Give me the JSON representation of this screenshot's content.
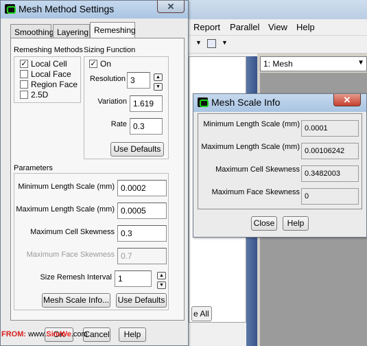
{
  "background": {
    "menu": [
      "Report",
      "Parallel",
      "View",
      "Help"
    ],
    "mesh_combo": "1: Mesh",
    "partial_button": "e All"
  },
  "dialog": {
    "title": "Mesh Method Settings",
    "tabs": [
      "Smoothing",
      "Layering",
      "Remeshing"
    ],
    "remeshing_methods": {
      "title": "Remeshing Methods",
      "items": [
        {
          "label": "Local Cell",
          "checked": true
        },
        {
          "label": "Local Face",
          "checked": false
        },
        {
          "label": "Region Face",
          "checked": false
        },
        {
          "label": "2.5D",
          "checked": false
        }
      ]
    },
    "sizing": {
      "title": "Sizing Function",
      "on_label": "On",
      "on_checked": true,
      "resolution_label": "Resolution",
      "resolution": "3",
      "variation_label": "Variation",
      "variation": "1.619",
      "rate_label": "Rate",
      "rate": "0.3",
      "defaults_btn": "Use Defaults"
    },
    "params": {
      "title": "Parameters",
      "min_len_label": "Minimum Length Scale (mm)",
      "min_len": "0.0002",
      "max_len_label": "Maximum Length Scale (mm)",
      "max_len": "0.0005",
      "max_cell_label": "Maximum Cell Skewness",
      "max_cell": "0.3",
      "max_face_label": "Maximum Face Skewness",
      "max_face": "0.7",
      "interval_label": "Size Remesh Interval",
      "interval": "1",
      "info_btn": "Mesh Scale Info...",
      "defaults_btn": "Use Defaults"
    },
    "footer": [
      "OK",
      "Cancel",
      "Help"
    ]
  },
  "info": {
    "title": "Mesh Scale Info",
    "rows": [
      {
        "label": "Minimum Length Scale (mm)",
        "value": "0.0001"
      },
      {
        "label": "Maximum Length Scale (mm)",
        "value": "0.00106242"
      },
      {
        "label": "Maximum Cell Skewness",
        "value": "0.3482003"
      },
      {
        "label": "Maximum Face Skewness",
        "value": "0"
      }
    ],
    "close_btn": "Close",
    "help_btn": "Help"
  },
  "watermark": {
    "prefix": "FROM:",
    "site_a": "www.",
    "site_b": "SimWe",
    "site_c": ".com"
  }
}
